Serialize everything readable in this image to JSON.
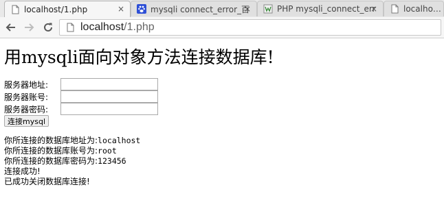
{
  "tabs": [
    {
      "label": "localhost/1.php",
      "icon": "page-icon",
      "active": true
    },
    {
      "label": "mysqli connect_error_百",
      "icon": "baidu-paw-icon",
      "active": false
    },
    {
      "label": "PHP mysqli_connect_err",
      "icon": "w3school-icon",
      "active": false
    },
    {
      "label": "localhost/l.p",
      "icon": "page-icon",
      "active": false
    }
  ],
  "tab_close": "×",
  "address": {
    "host": "localhost",
    "path": "/1.php"
  },
  "page": {
    "heading": "用mysqli面向对象方法连接数据库!",
    "form": {
      "host_label": "服务器地址:",
      "user_label": "服务器账号:",
      "pass_label": "服务器密码:",
      "host_value": "",
      "user_value": "",
      "pass_value": "",
      "submit_label": "连接mysql"
    },
    "output": {
      "host_prefix": "你所连接的数据库地址为:",
      "host_value": "localhost",
      "user_prefix": "你所连接的数据库账号为:",
      "user_value": "root",
      "pass_prefix": "你所连接的数据库密码为:",
      "pass_value": "123456",
      "success": "连接成功!",
      "closed": "已成功关闭数据库连接!"
    }
  },
  "colors": {
    "tabstrip": "#e9e9e9",
    "toolbar": "#f6f6f6",
    "baidu_blue": "#2e4fd6"
  }
}
